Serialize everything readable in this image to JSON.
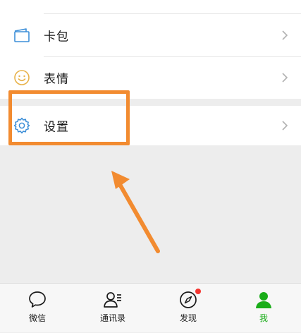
{
  "menu": {
    "card_package": "卡包",
    "stickers": "表情",
    "settings": "设置"
  },
  "tabs": [
    {
      "label": "微信",
      "icon": "chat-bubble-icon",
      "active": false
    },
    {
      "label": "通讯录",
      "icon": "contacts-icon",
      "active": false
    },
    {
      "label": "发现",
      "icon": "compass-icon",
      "active": false,
      "badge": true
    },
    {
      "label": "我",
      "icon": "person-icon",
      "active": true
    }
  ],
  "colors": {
    "accent": "#1aad19",
    "icon_blue": "#3d8fd8",
    "icon_yellow": "#e8b24a",
    "highlight": "#f28b30",
    "badge": "#f43530"
  }
}
